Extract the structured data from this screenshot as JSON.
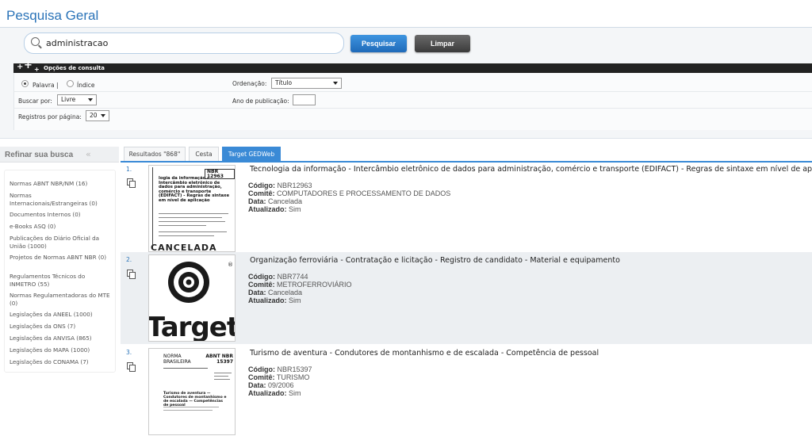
{
  "header": {
    "title": "Pesquisa Geral"
  },
  "search": {
    "value": "administracao",
    "search_label": "Pesquisar",
    "clear_label": "Limpar"
  },
  "options": {
    "bar_label": "Opções de consulta",
    "radio_word": "Palavra |",
    "radio_index": "Índice",
    "sort_label": "Ordenação:",
    "sort_value": "Título",
    "search_by_label": "Buscar por:",
    "search_by_value": "Livre",
    "year_label": "Ano de publicação:",
    "per_page_label": "Registros por página:",
    "per_page_value": "20"
  },
  "sidebar": {
    "title": "Refinar sua busca",
    "items": [
      {
        "label": "Normas ABNT NBR/NM (16)"
      },
      {
        "label": "Normas Internacionais/Estrangeiras (0)"
      },
      {
        "label": "Documentos Internos (0)"
      },
      {
        "label": "e-Books ASQ (0)"
      },
      {
        "label": "Publicações do Diário Oficial da União (1000)"
      },
      {
        "label": "Projetos de Normas ABNT NBR (0)"
      },
      {
        "label": "Regulamentos Técnicos do INMETRO (55)"
      },
      {
        "label": "Normas Regulamentadoras do MTE (0)"
      },
      {
        "label": "Legislações da ANEEL (1000)"
      },
      {
        "label": "Legislações da ONS (7)"
      },
      {
        "label": "Legislações da ANVISA (865)"
      },
      {
        "label": "Legislações do MAPA (1000)"
      },
      {
        "label": "Legislações do CONAMA (7)"
      }
    ]
  },
  "tabs": [
    {
      "label": "Resultados \"868\""
    },
    {
      "label": "Cesta"
    },
    {
      "label": "Target GEDWeb"
    }
  ],
  "field_labels": {
    "code": "Código:",
    "committee": "Comitê:",
    "status": "Data:",
    "updated": "Atualizado:"
  },
  "results": [
    {
      "number": "1.",
      "title": "Tecnologia da informação - Intercâmbio eletrônico de dados para administração, comércio e transporte (EDIFACT) - Regras de sintaxe em nível de aplicação",
      "code": "NBR12963",
      "committee": "COMPUTADORES E PROCESSAMENTO DE DADOS",
      "status": "Cancelada",
      "updated": "Sim",
      "thumb": {
        "code": "NBR 12963",
        "heading": "logia da informação - Intercâmbio eletrônico de dados para administração, comércio e transporte (EDIFACT) - Regras de sintaxe em nível de aplicação",
        "stamp": "CANCELADA"
      }
    },
    {
      "number": "2.",
      "title": "Organização ferroviária - Contratação e licitação - Registro de candidato - Material e equipamento",
      "code": "NBR7744",
      "committee": "METROFERROVIÁRIO",
      "status": "Cancelada",
      "updated": "Sim",
      "thumb": {
        "logo_text": "Target",
        "reg": "®"
      }
    },
    {
      "number": "3.",
      "title": "Turismo de aventura - Condutores de montanhismo e de escalada - Competência de pessoal",
      "code": "NBR15397",
      "committee": "TURISMO",
      "status": "09/2006",
      "updated": "Sim",
      "thumb": {
        "left_head": "NORMA BRASILEIRA",
        "right_head": "ABNT NBR 15397",
        "heading": "Turismo de aventura — Condutores de montanhismo e de escalada — Competências de pessoal"
      }
    }
  ]
}
